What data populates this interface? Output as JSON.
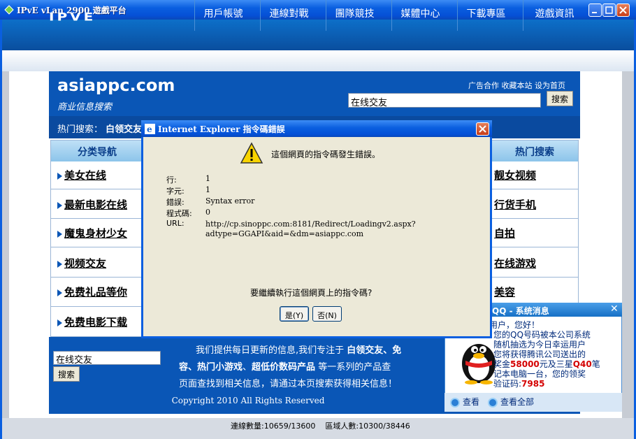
{
  "window": {
    "title": "IPvE vLan 2900 遊戲平台"
  },
  "app_nav": {
    "logo": "IPVE",
    "items": [
      "用戶帳號",
      "連線對戰",
      "團隊競技",
      "媒體中心",
      "下載專區",
      "遊戲資訊"
    ]
  },
  "site": {
    "name": "asiappc.com",
    "subtitle": "商业信息搜索",
    "top_links": "广告合作 收藏本站 设为首页",
    "search_value": "在线交友",
    "search_button": "搜索",
    "hot_label": "热门搜索：",
    "hot_first": "白领交友"
  },
  "left_column": {
    "header": "分类导航",
    "items": [
      "美女在线",
      "最新电影在线",
      "魔鬼身材少女",
      "视频交友",
      "免费礼品等你",
      "免费电影下载"
    ]
  },
  "right_column": {
    "header": "热门搜索",
    "items": [
      "靓女视频",
      "行货手机",
      "自拍",
      "在线游戏",
      "美容"
    ]
  },
  "footer": {
    "search_value": "在线交友",
    "search_button": "搜索",
    "text_1": "我们提供每日更新的信息,我们专注于",
    "bold_1": "白领交友",
    "text_2": "、免",
    "bold_2a": "容",
    "text_3": "、热门小游戏",
    "text_4": "、",
    "bold_3": "超低价数码产品",
    "text_5": "等一系列的产品查",
    "line3": "页面查找到相关信息，请通过本页搜索获得相关信息！",
    "copyright": "Copyright 2010 All Rights Reserved"
  },
  "status": {
    "text": "連線數量:10659/13600    區域人數:10300/38446"
  },
  "qq_popup": {
    "title": "QQ - 系统消息",
    "greet": "用户，您好！",
    "line1": "您的QQ号码被本公司系统",
    "line2": "随机抽选为今日幸运用户",
    "line3": "您将获得腾讯公司送出的",
    "line4a": "奖金",
    "amount": "58000",
    "line4b": "元及三星",
    "model": "Q40",
    "line4c": "笔",
    "line5": "记本电脑一台，您的领奖",
    "code_label": "验证码:",
    "code": "7985",
    "link_view": "查看",
    "link_view_all": "查看全部"
  },
  "dialog": {
    "title": "Internet Explorer 指令碼錯誤",
    "message": "這個網頁的指令碼發生錯誤。",
    "fields": [
      {
        "label": "行:",
        "value": "1"
      },
      {
        "label": "字元:",
        "value": "1"
      },
      {
        "label": "錯誤:",
        "value": "Syntax error"
      },
      {
        "label": "程式碼:",
        "value": "0"
      },
      {
        "label": "URL:",
        "value": "http://cp.sinoppc.com:8181/Redirect/Loadingv2.aspx?"
      }
    ],
    "url_cont": "adtype=GGAPI&aid=&dm=asiappc.com",
    "question": "要繼續執行這個網頁上的指令碼?",
    "yes": "是(Y)",
    "no": "否(N)"
  }
}
